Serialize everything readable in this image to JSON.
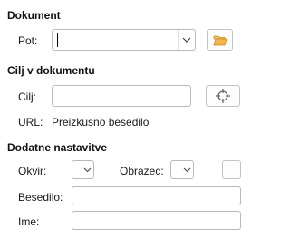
{
  "document": {
    "title": "Dokument",
    "path_label": "Pot:",
    "path_value": ""
  },
  "target": {
    "title": "Cilj v dokumentu",
    "target_label": "Cilj:",
    "target_value": "",
    "url_label": "URL:",
    "url_value": "Preizkusno besedilo"
  },
  "extra": {
    "title": "Dodatne nastavitve",
    "frame_label": "Okvir:",
    "frame_value": "",
    "form_label": "Obrazec:",
    "form_value": "",
    "text_label": "Besedilo:",
    "text_value": "",
    "name_label": "Ime:",
    "name_value": ""
  },
  "icons": {
    "combo_arrow": "chevron-down-icon",
    "open_file": "folder-open-icon",
    "target": "crosshair-target-icon"
  },
  "colors": {
    "folder": "#e8a33c",
    "field_border": "#b9b9b9"
  }
}
